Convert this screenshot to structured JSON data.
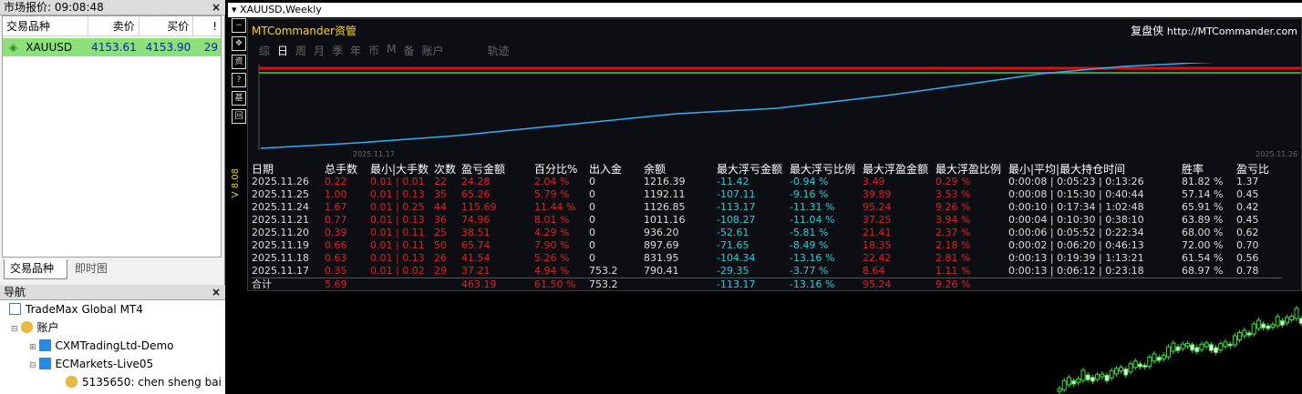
{
  "market_watch": {
    "title": "市场报价: 09:08:48",
    "close": "×",
    "col_symbol": "交易品种",
    "col_bid": "卖价",
    "col_ask": "买价",
    "col_spread": "!",
    "rows": [
      {
        "symbol": "XAUUSD",
        "bid": "4153.61",
        "ask": "4153.90",
        "spread": "29"
      }
    ],
    "tab_symbols": "交易品种",
    "tab_ticks": "即时图"
  },
  "navigator": {
    "title": "导航",
    "close": "×",
    "items": [
      {
        "label": "TradeMax Global MT4"
      },
      {
        "label": "账户"
      },
      {
        "label": "CXMTradingLtd-Demo"
      },
      {
        "label": "ECMarkets-Live05"
      },
      {
        "label": "5135650: chen sheng bai"
      }
    ]
  },
  "chart_window": {
    "title": "XAUUSD,Weekly",
    "version": "V 8.08",
    "toolbar": [
      "−",
      "✥",
      "资",
      "?",
      "基",
      "回"
    ]
  },
  "mtc": {
    "title": "MTCommander资管",
    "brand": "复盘侠",
    "url": "http://MTCommander.com",
    "tabs": [
      "综",
      "日",
      "周",
      "月",
      "季",
      "年",
      "币",
      "M",
      "备",
      "账户",
      "轨迹"
    ],
    "selected_tab": "日",
    "date_start": "2025.11.17",
    "date_end": "2025.11.26",
    "headers": [
      "日期",
      "总手数",
      "最小|大手数",
      "次数",
      "盈亏金额",
      "百分比%",
      "出入金",
      "余额",
      "最大浮亏金额",
      "最大浮亏比例",
      "最大浮盈金额",
      "最大浮盈比例",
      "最小|平均|最大持仓时间",
      "胜率",
      "盈亏比"
    ],
    "rows": [
      [
        "2025.11.26",
        "0.22",
        "0.01 | 0.01",
        "22",
        "24.28",
        "2.04 %",
        "0",
        "1216.39",
        "-11.42",
        "-0.94 %",
        "3.49",
        "0.29 %",
        "0:00:08 | 0:05:23 | 0:13:26",
        "81.82 %",
        "1.37"
      ],
      [
        "2025.11.25",
        "1.00",
        "0.01 | 0.13",
        "35",
        "65.26",
        "5.79 %",
        "0",
        "1192.11",
        "-107.11",
        "-9.16 %",
        "39.89",
        "3.53 %",
        "0:00:08 | 0:15:30 | 0:40:44",
        "57.14 %",
        "0.45"
      ],
      [
        "2025.11.24",
        "1.67",
        "0.01 | 0.25",
        "44",
        "115.69",
        "11.44 %",
        "0",
        "1126.85",
        "-113.17",
        "-11.31 %",
        "95.24",
        "9.26 %",
        "0:00:10 | 0:17:34 | 1:02:48",
        "65.91 %",
        "0.42"
      ],
      [
        "2025.11.21",
        "0.77",
        "0.01 | 0.13",
        "36",
        "74.96",
        "8.01 %",
        "0",
        "1011.16",
        "-108.27",
        "-11.04 %",
        "37.25",
        "3.94 %",
        "0:00:04 | 0:10:30 | 0:38:10",
        "63.89 %",
        "0.45"
      ],
      [
        "2025.11.20",
        "0.39",
        "0.01 | 0.11",
        "25",
        "38.51",
        "4.29 %",
        "0",
        "936.20",
        "-52.61",
        "-5.81 %",
        "21.41",
        "2.37 %",
        "0:00:06 | 0:05:52 | 0:22:34",
        "68.00 %",
        "0.62"
      ],
      [
        "2025.11.19",
        "0.66",
        "0.01 | 0.11",
        "50",
        "65.74",
        "7.90 %",
        "0",
        "897.69",
        "-71.65",
        "-8.49 %",
        "18.35",
        "2.18 %",
        "0:00:02 | 0:06:20 | 0:46:13",
        "72.00 %",
        "0.70"
      ],
      [
        "2025.11.18",
        "0.63",
        "0.01 | 0.13",
        "26",
        "41.54",
        "5.26 %",
        "0",
        "831.95",
        "-104.34",
        "-13.16 %",
        "22.42",
        "2.81 %",
        "0:00:13 | 0:19:39 | 1:13:21",
        "61.54 %",
        "0.56"
      ],
      [
        "2025.11.17",
        "0.35",
        "0.01 | 0.02",
        "29",
        "37.21",
        "4.94 %",
        "753.2",
        "790.41",
        "-29.35",
        "-3.77 %",
        "8.64",
        "1.11 %",
        "0:00:13 | 0:06:12 | 0:23:18",
        "68.97 %",
        "0.78"
      ]
    ],
    "total": [
      "合计",
      "5.69",
      "",
      "",
      "463.19",
      "61.50 %",
      "753.2",
      "",
      "-113.17",
      "-13.16 %",
      "95.24",
      "9.26 %",
      "",
      "",
      ""
    ]
  },
  "colors": {
    "red": "#e02020",
    "cyan": "#20d0e0",
    "gold": "#ffd700",
    "highlight": "#8ee07a"
  }
}
